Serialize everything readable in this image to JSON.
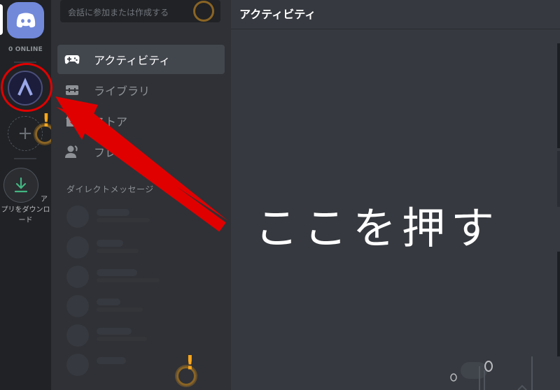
{
  "rail": {
    "online_label": "0 ONLINE",
    "download_label_a": "ア",
    "download_label_rest": "プリをダウンロード"
  },
  "search": {
    "placeholder": "会話に参加または作成する"
  },
  "nav": {
    "items": [
      {
        "label": "アクティビティ",
        "icon": "gamepad-icon",
        "active": true
      },
      {
        "label": "ライブラリ",
        "icon": "library-icon",
        "active": false
      },
      {
        "label": "ストア",
        "icon": "store-icon",
        "active": false
      },
      {
        "label": "フレンド",
        "icon": "friends-icon",
        "active": false
      }
    ]
  },
  "dm": {
    "header": "ダイレクトメッセージ"
  },
  "main": {
    "title": "アクティビティ"
  },
  "annotation": {
    "callout": "ここを押す"
  },
  "colors": {
    "blurple": "#7289da",
    "annotation_red": "#e00000",
    "beacon_orange": "#faa61a",
    "download_green": "#43b581"
  }
}
